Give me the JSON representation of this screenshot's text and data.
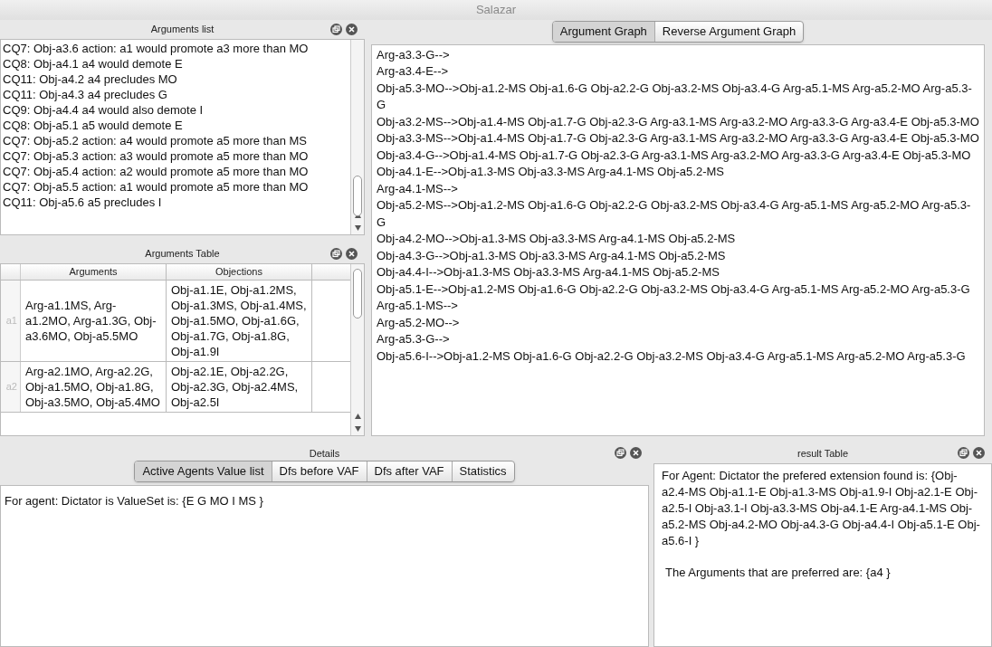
{
  "window": {
    "title": "Salazar"
  },
  "arguments_list": {
    "title": "Arguments list",
    "items": [
      "CQ7: Obj-a3.6 action: a1 would promote a3 more than MO",
      "CQ8: Obj-a4.1 a4 would demote E",
      "CQ11: Obj-a4.2 a4 precludes MO",
      "CQ11: Obj-a4.3 a4 precludes G",
      "CQ9: Obj-a4.4 a4 would also demote I",
      "CQ8: Obj-a5.1 a5 would demote E",
      "CQ7: Obj-a5.2 action: a4 would promote a5 more than MS",
      "CQ7: Obj-a5.3 action: a3 would promote a5 more than MO",
      "CQ7: Obj-a5.4 action: a2 would promote a5 more than MO",
      "CQ7: Obj-a5.5 action: a1 would promote a5 more than MO",
      "CQ11: Obj-a5.6 a5 precludes I"
    ]
  },
  "arguments_table": {
    "title": "Arguments Table",
    "columns": [
      "Arguments",
      "Objections"
    ],
    "rows": [
      {
        "header": "a1",
        "cells": [
          "Arg-a1.1MS, Arg-a1.2MO, Arg-a1.3G, Obj-a3.6MO, Obj-a5.5MO",
          "Obj-a1.1E, Obj-a1.2MS, Obj-a1.3MS, Obj-a1.4MS, Obj-a1.5MO, Obj-a1.6G, Obj-a1.7G, Obj-a1.8G, Obj-a1.9I"
        ]
      },
      {
        "header": "a2",
        "cells": [
          "Arg-a2.1MO, Arg-a2.2G, Obj-a1.5MO, Obj-a1.8G, Obj-a3.5MO, Obj-a5.4MO",
          "Obj-a2.1E, Obj-a2.2G, Obj-a2.3G, Obj-a2.4MS, Obj-a2.5I"
        ]
      }
    ]
  },
  "graph": {
    "tabs": [
      {
        "label": "Argument Graph",
        "selected": true
      },
      {
        "label": "Reverse Argument Graph",
        "selected": false
      }
    ],
    "lines": [
      "Arg-a3.3-G-->",
      "Arg-a3.4-E-->",
      "Obj-a5.3-MO-->Obj-a1.2-MS Obj-a1.6-G Obj-a2.2-G Obj-a3.2-MS Obj-a3.4-G Arg-a5.1-MS Arg-a5.2-MO Arg-a5.3-G",
      "Obj-a3.2-MS-->Obj-a1.4-MS Obj-a1.7-G Obj-a2.3-G Arg-a3.1-MS Arg-a3.2-MO Arg-a3.3-G Arg-a3.4-E Obj-a5.3-MO",
      "Obj-a3.3-MS-->Obj-a1.4-MS Obj-a1.7-G Obj-a2.3-G Arg-a3.1-MS Arg-a3.2-MO Arg-a3.3-G Arg-a3.4-E Obj-a5.3-MO",
      "Obj-a3.4-G-->Obj-a1.4-MS Obj-a1.7-G Obj-a2.3-G Arg-a3.1-MS Arg-a3.2-MO Arg-a3.3-G Arg-a3.4-E Obj-a5.3-MO",
      "Obj-a4.1-E-->Obj-a1.3-MS Obj-a3.3-MS Arg-a4.1-MS Obj-a5.2-MS",
      "Arg-a4.1-MS-->",
      "Obj-a5.2-MS-->Obj-a1.2-MS Obj-a1.6-G Obj-a2.2-G Obj-a3.2-MS Obj-a3.4-G Arg-a5.1-MS Arg-a5.2-MO Arg-a5.3-G",
      "Obj-a4.2-MO-->Obj-a1.3-MS Obj-a3.3-MS Arg-a4.1-MS Obj-a5.2-MS",
      "Obj-a4.3-G-->Obj-a1.3-MS Obj-a3.3-MS Arg-a4.1-MS Obj-a5.2-MS",
      "Obj-a4.4-I-->Obj-a1.3-MS Obj-a3.3-MS Arg-a4.1-MS Obj-a5.2-MS",
      "Obj-a5.1-E-->Obj-a1.2-MS Obj-a1.6-G Obj-a2.2-G Obj-a3.2-MS Obj-a3.4-G Arg-a5.1-MS Arg-a5.2-MO Arg-a5.3-G",
      "Arg-a5.1-MS-->",
      "Arg-a5.2-MO-->",
      "Arg-a5.3-G-->",
      "Obj-a5.6-I-->Obj-a1.2-MS Obj-a1.6-G Obj-a2.2-G Obj-a3.2-MS Obj-a3.4-G Arg-a5.1-MS Arg-a5.2-MO Arg-a5.3-G"
    ]
  },
  "details": {
    "title": "Details",
    "tabs": [
      {
        "label": "Active Agents Value list",
        "selected": true
      },
      {
        "label": "Dfs before VAF",
        "selected": false
      },
      {
        "label": "Dfs after VAF",
        "selected": false
      },
      {
        "label": "Statistics",
        "selected": false
      }
    ],
    "text": "For agent: Dictator is ValueSet is: {E G MO I MS }"
  },
  "result_table": {
    "title": "result Table",
    "paragraphs": [
      "For Agent: Dictator the prefered extension found is: {Obj-a2.4-MS Obj-a1.1-E Obj-a1.3-MS Obj-a1.9-I Obj-a2.1-E Obj-a2.5-I Obj-a3.1-I Obj-a3.3-MS Obj-a4.1-E Arg-a4.1-MS Obj-a5.2-MS Obj-a4.2-MO Obj-a4.3-G Obj-a4.4-I Obj-a5.1-E Obj-a5.6-I }",
      "The Arguments that are preferred are: {a4 }"
    ]
  }
}
